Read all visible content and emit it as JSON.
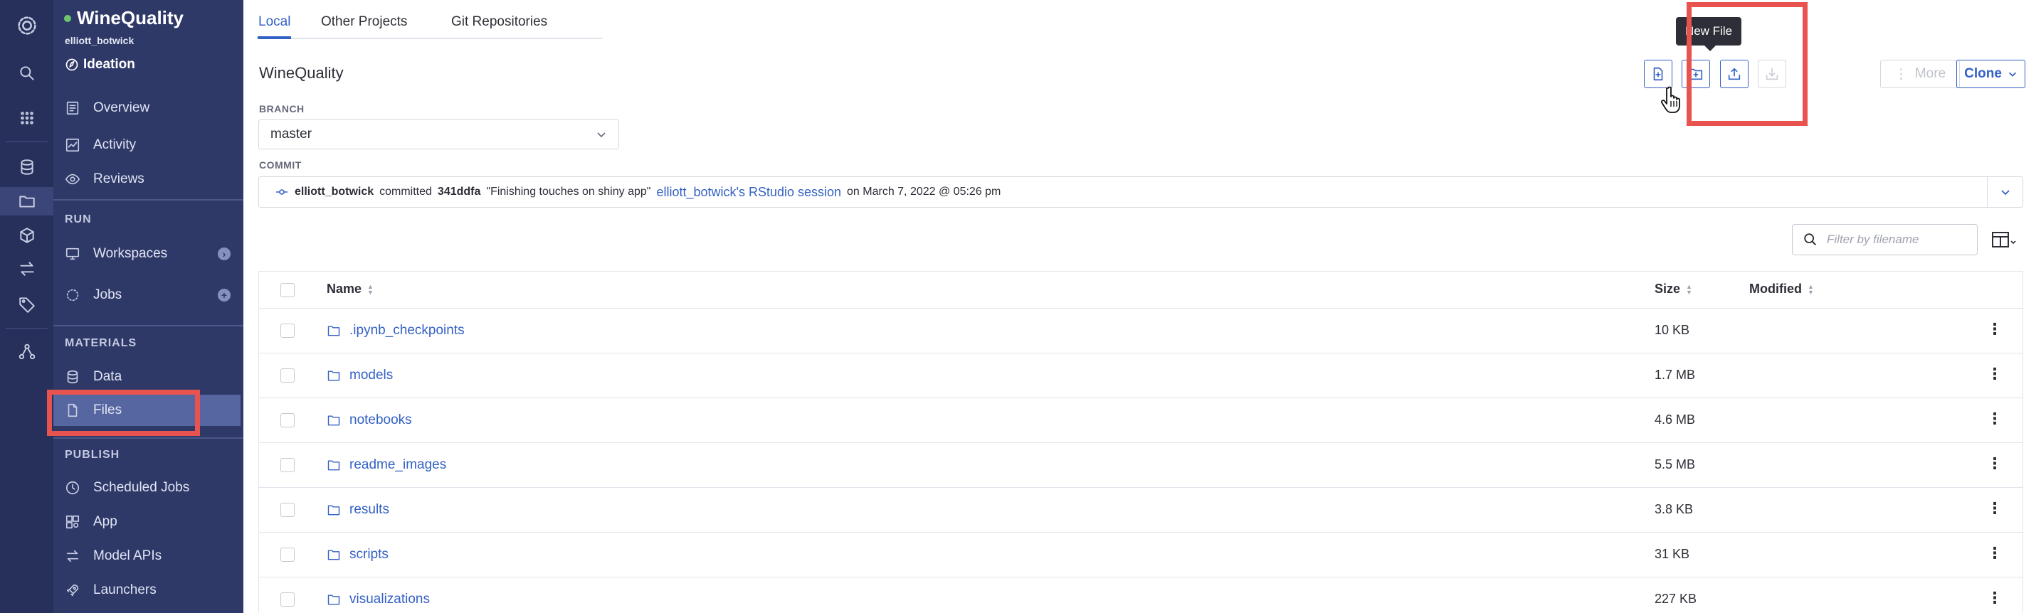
{
  "project": {
    "name": "WineQuality",
    "owner": "elliott_botwick",
    "stage": "Ideation"
  },
  "sidebar": {
    "top_items": [
      {
        "label": "Overview",
        "icon": "overview-icon"
      },
      {
        "label": "Activity",
        "icon": "activity-icon"
      },
      {
        "label": "Reviews",
        "icon": "reviews-icon"
      }
    ],
    "run_section": "RUN",
    "run_items": [
      {
        "label": "Workspaces",
        "icon": "monitor-icon",
        "badge": "›"
      },
      {
        "label": "Jobs",
        "icon": "jobs-icon",
        "badge": "+"
      }
    ],
    "materials_section": "MATERIALS",
    "materials_items": [
      {
        "label": "Data",
        "icon": "database-icon"
      },
      {
        "label": "Files",
        "icon": "file-icon"
      }
    ],
    "publish_section": "PUBLISH",
    "publish_items": [
      {
        "label": "Scheduled Jobs",
        "icon": "clock-icon"
      },
      {
        "label": "App",
        "icon": "app-icon"
      },
      {
        "label": "Model APIs",
        "icon": "swap-icon"
      },
      {
        "label": "Launchers",
        "icon": "rocket-icon"
      }
    ]
  },
  "tabs": [
    {
      "label": "Local"
    },
    {
      "label": "Other Projects"
    },
    {
      "label": "Git Repositories"
    }
  ],
  "page_title": "WineQuality",
  "branch": {
    "label": "BRANCH",
    "value": "master"
  },
  "commit": {
    "label": "COMMIT",
    "author": "elliott_botwick",
    "verb": "committed",
    "hash": "341ddfa",
    "message": "\"Finishing touches on shiny app\"",
    "session": "elliott_botwick's RStudio session",
    "date": "on March 7, 2022 @ 05:26 pm"
  },
  "toolbar": {
    "tooltip": "New File",
    "more_label": "More",
    "clone_label": "Clone"
  },
  "search": {
    "placeholder": "Filter by filename"
  },
  "table": {
    "headers": {
      "name": "Name",
      "size": "Size",
      "modified": "Modified"
    },
    "rows": [
      {
        "name": ".ipynb_checkpoints",
        "size": "10 KB"
      },
      {
        "name": "models",
        "size": "1.7 MB"
      },
      {
        "name": "notebooks",
        "size": "4.6 MB"
      },
      {
        "name": "readme_images",
        "size": "5.5 MB"
      },
      {
        "name": "results",
        "size": "3.8 KB"
      },
      {
        "name": "scripts",
        "size": "31 KB"
      },
      {
        "name": "visualizations",
        "size": "227 KB"
      }
    ]
  },
  "colors": {
    "rail_bg": "#27305a",
    "sidebar_bg": "#2e3968",
    "accent": "#3461c5",
    "highlight": "#e8534f"
  }
}
